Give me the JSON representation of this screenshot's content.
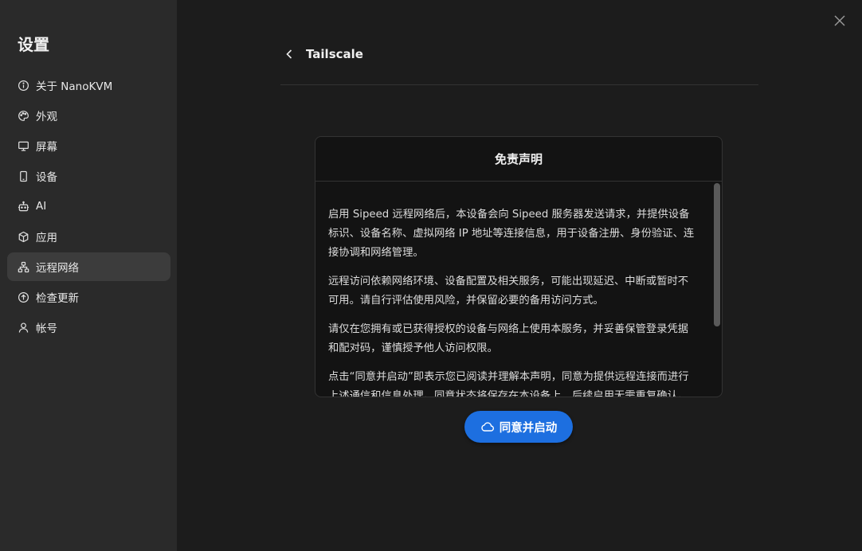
{
  "sidebar": {
    "title": "设置",
    "items": [
      {
        "label": "关于 NanoKVM",
        "icon": "info-icon"
      },
      {
        "label": "外观",
        "icon": "palette-icon"
      },
      {
        "label": "屏幕",
        "icon": "monitor-icon"
      },
      {
        "label": "设备",
        "icon": "phone-icon"
      },
      {
        "label": "AI",
        "icon": "robot-icon"
      },
      {
        "label": "应用",
        "icon": "package-icon"
      },
      {
        "label": "远程网络",
        "icon": "network-icon",
        "active": true
      },
      {
        "label": "检查更新",
        "icon": "upload-circle-icon"
      },
      {
        "label": "帐号",
        "icon": "user-icon"
      }
    ]
  },
  "header": {
    "title": "Tailscale"
  },
  "disclaimer": {
    "title": "免责声明",
    "paragraphs": [
      "启用 Sipeed 远程网络后，本设备会向 Sipeed 服务器发送请求，并提供设备标识、设备名称、虚拟网络 IP 地址等连接信息，用于设备注册、身份验证、连接协调和网络管理。",
      "远程访问依赖网络环境、设备配置及相关服务，可能出现延迟、中断或暂时不可用。请自行评估使用风险，并保留必要的备用访问方式。",
      "请仅在您拥有或已获得授权的设备与网络上使用本服务，并妥善保管登录凭据和配对码，谨慎授予他人访问权限。",
      "点击“同意并启动”即表示您已阅读并理解本声明，同意为提供远程连接而进行上述通信和信息处理。同意状态将保存在本设备上，后续启用无需重复确认。"
    ]
  },
  "actions": {
    "agree_label": "同意并启动"
  },
  "colors": {
    "accent": "#1d6fe0",
    "sidebar_bg": "#2a2a2a",
    "main_bg": "#1c1c1c",
    "active_item": "#3c3c3c"
  }
}
